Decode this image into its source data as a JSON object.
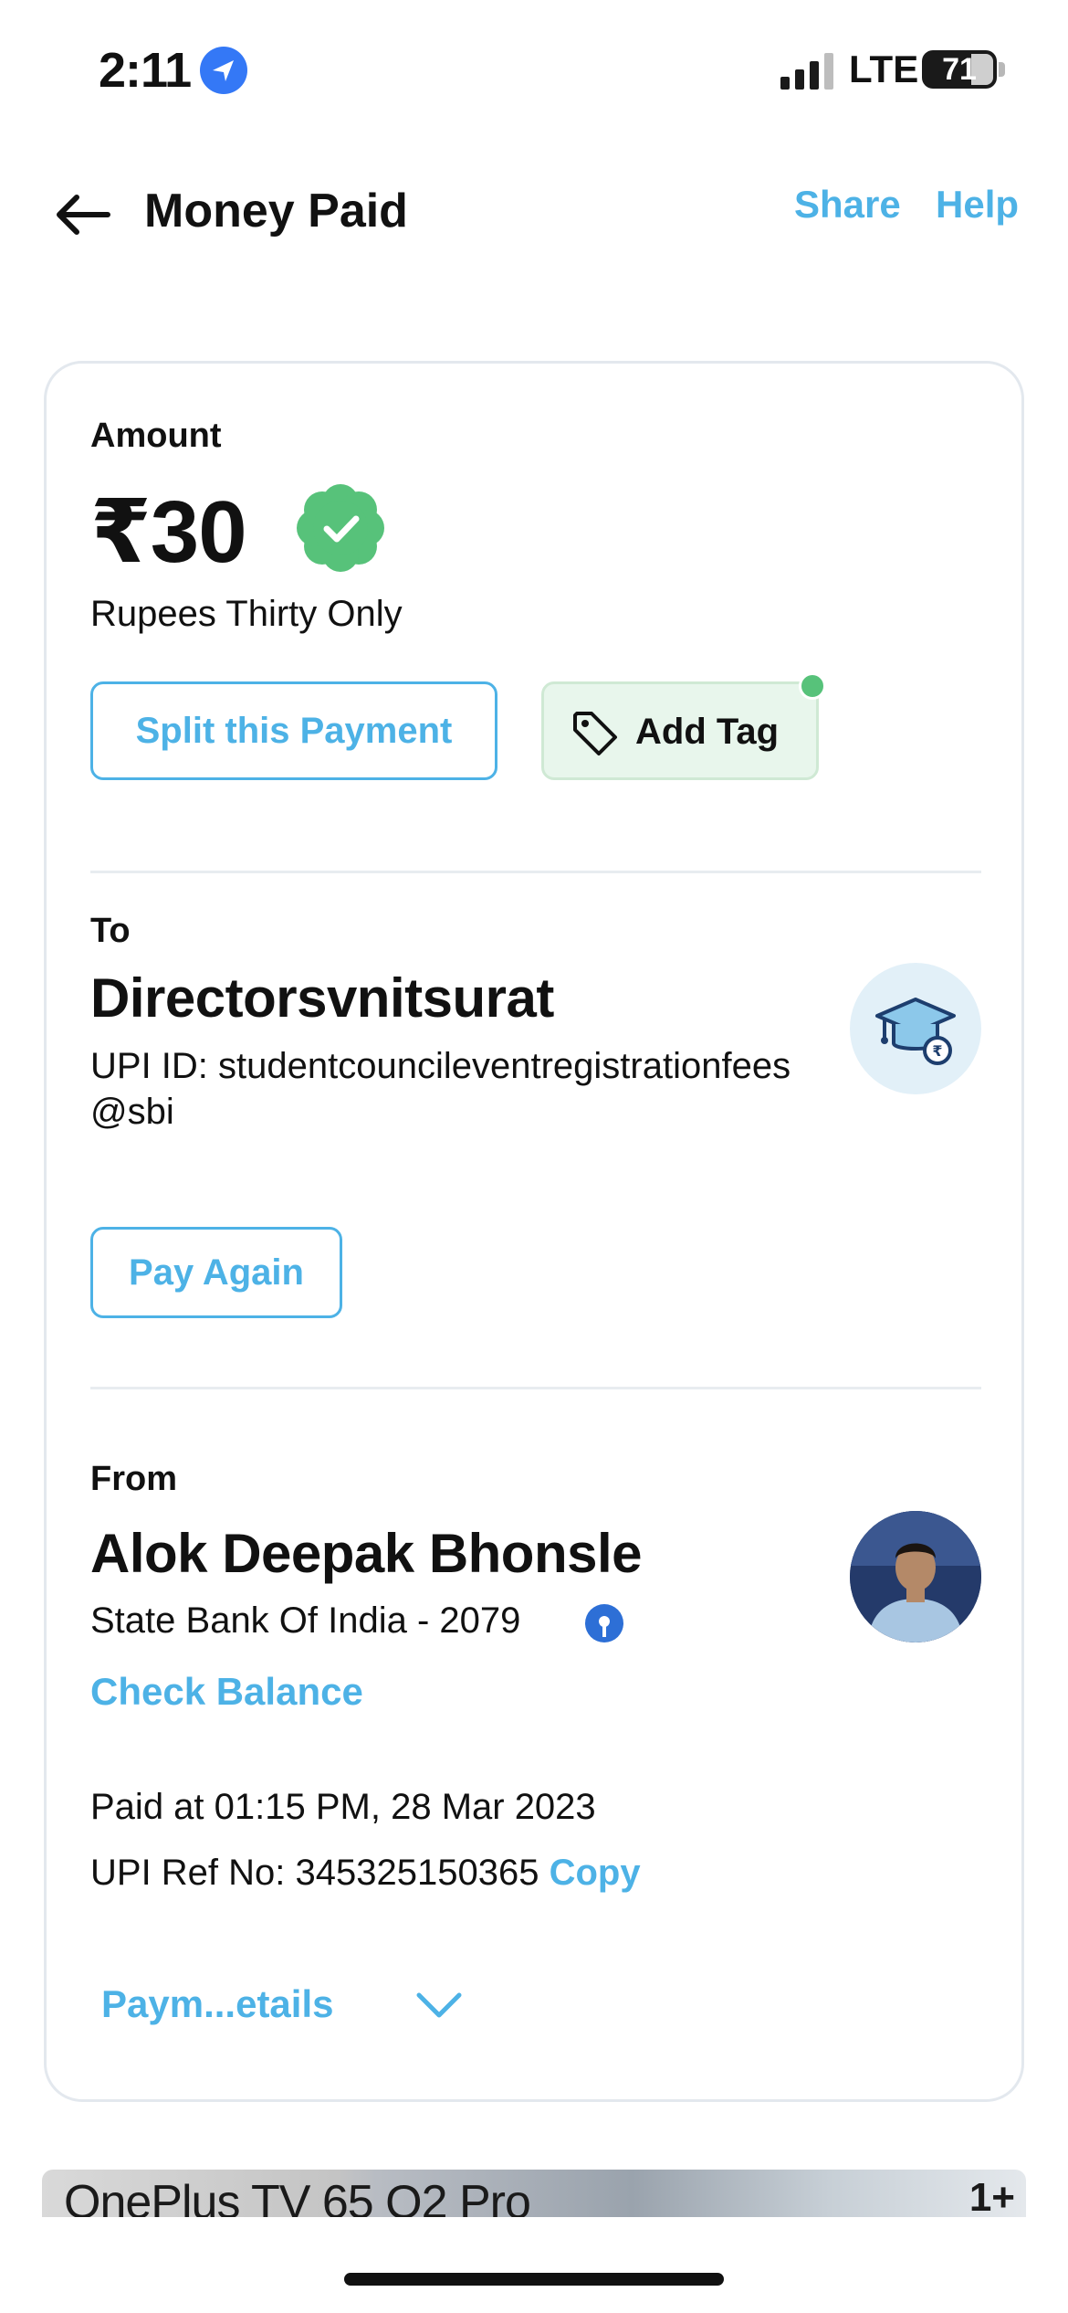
{
  "status_bar": {
    "time": "2:11",
    "network": "LTE",
    "battery": "71",
    "battery_level": 0.71
  },
  "header": {
    "title": "Money Paid",
    "share": "Share",
    "help": "Help"
  },
  "amount": {
    "label": "Amount",
    "value": "₹30",
    "words": "Rupees Thirty Only",
    "split_button": "Split this Payment",
    "tag_button": "Add Tag"
  },
  "to": {
    "label": "To",
    "name": "Directorsvnitsurat",
    "upi": "UPI ID: studentcouncileventregistrationfees@sbi",
    "pay_again": "Pay Again"
  },
  "from": {
    "label": "From",
    "name": "Alok Deepak Bhonsle",
    "bank": "State Bank Of India - 2079",
    "check_balance": "Check Balance",
    "paid_at": "Paid at 01:15 PM, 28 Mar 2023",
    "ref_label": "UPI Ref No: 345325150365",
    "copy": "Copy",
    "details": "Paym...etails"
  },
  "banner": {
    "text": "OnePlus TV 65 Q2 Pro",
    "logo": "1+"
  },
  "colors": {
    "accent": "#4db2e6",
    "verified": "#57c27a",
    "tag_bg": "#e8f6ec"
  },
  "icons": [
    "location-arrow-icon",
    "signal-icon",
    "back-arrow-icon",
    "verified-badge-icon",
    "tag-icon",
    "graduation-cap-icon",
    "bank-icon",
    "chevron-down-icon"
  ]
}
